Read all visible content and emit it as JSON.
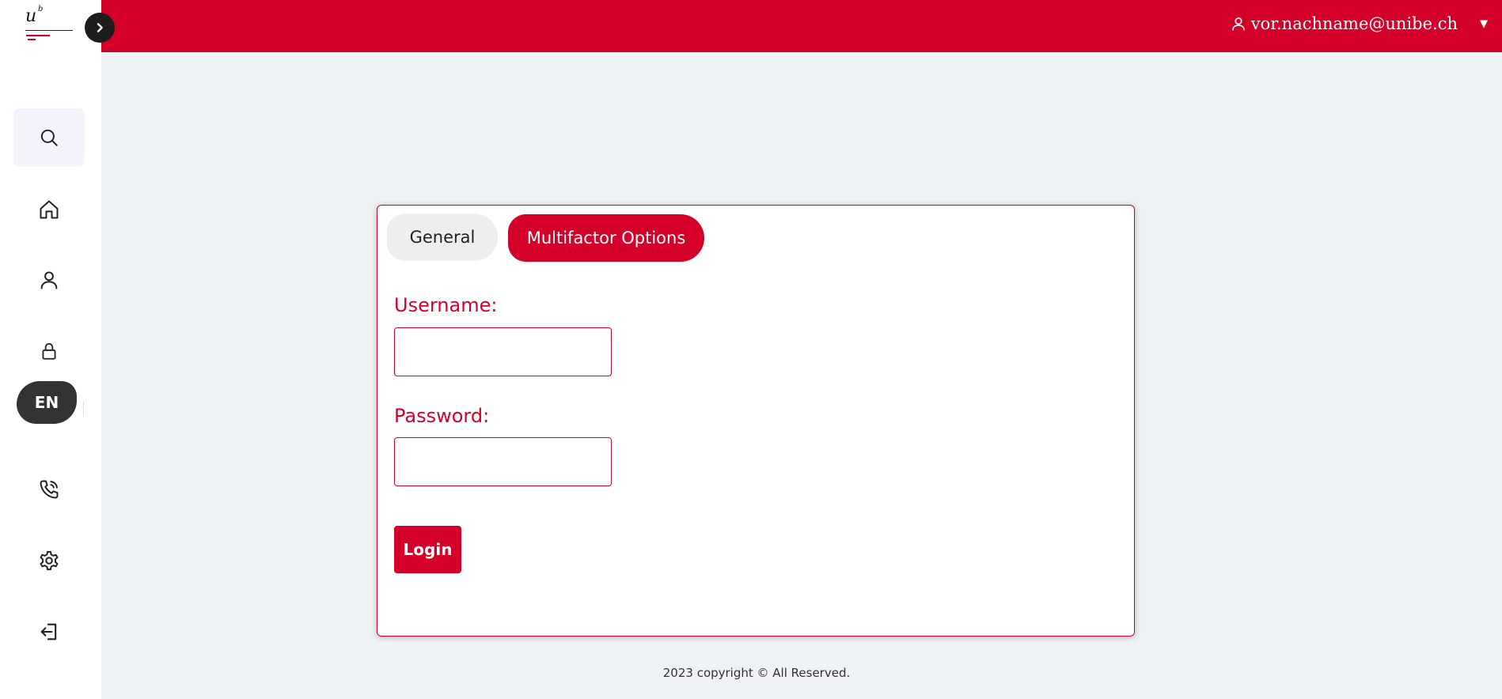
{
  "header": {
    "user_email": "vor.nachname@unibe.ch",
    "user_icon": "user-icon",
    "dropdown_caret": "▼"
  },
  "logo": {
    "letter_u": "u",
    "letter_b": "b"
  },
  "sidebar": {
    "toggle_icon": "chevron-right-icon",
    "items": [
      {
        "name": "search",
        "icon": "search-icon",
        "active": true
      },
      {
        "name": "home",
        "icon": "home-icon"
      },
      {
        "name": "profile",
        "icon": "user-icon"
      },
      {
        "name": "security",
        "icon": "lock-icon"
      },
      {
        "name": "phone",
        "icon": "phone-call-icon"
      },
      {
        "name": "settings",
        "icon": "gear-icon"
      },
      {
        "name": "logout",
        "icon": "logout-icon"
      }
    ],
    "language": "EN"
  },
  "form": {
    "tabs": [
      {
        "label": "General",
        "active": false
      },
      {
        "label": "Multifactor Options",
        "active": true
      }
    ],
    "username_label": "Username:",
    "username_value": "",
    "password_label": "Password:",
    "password_value": "",
    "login_label": "Login"
  },
  "footer": {
    "text": "2023 copyright © All Reserved."
  },
  "colors": {
    "accent": "#d50029",
    "background": "#eff2f4",
    "sidebar": "#ffffff",
    "dark": "#1d1d1d"
  }
}
